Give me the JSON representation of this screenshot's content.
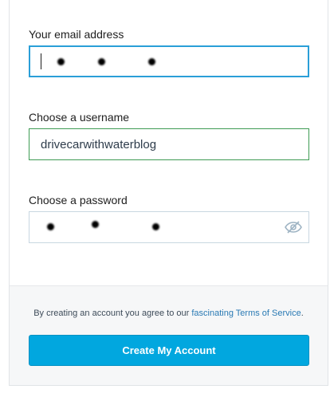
{
  "form": {
    "email": {
      "label": "Your email address",
      "masked_dot_count": 3
    },
    "username": {
      "label": "Choose a username",
      "value": "drivecarwithwaterblog"
    },
    "password": {
      "label": "Choose a password",
      "masked_dot_count": 3,
      "visibility_icon": "eye-slash-icon"
    }
  },
  "footer": {
    "terms_prefix": "By creating an account you agree to our ",
    "terms_link": "fascinating Terms of Service",
    "terms_suffix": ".",
    "create_button_label": "Create My Account"
  },
  "colors": {
    "primary_button": "#01a7df",
    "focus_border": "#2a9fd8",
    "valid_border": "#3e9b54",
    "link": "#2a7ab4"
  }
}
